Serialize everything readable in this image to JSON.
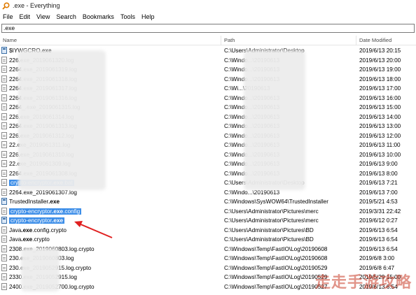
{
  "window": {
    "title": ".exe - Everything"
  },
  "menu": [
    "File",
    "Edit",
    "View",
    "Search",
    "Bookmarks",
    "Tools",
    "Help"
  ],
  "search": {
    "value": ".exe"
  },
  "columns": {
    "name": "Name",
    "path": "Path",
    "date": "Date Modified"
  },
  "rows": [
    {
      "pre": "$IYWGCRO",
      "bold": ".exe",
      "post": "",
      "icon": "exe",
      "path": "C:\\Users\\Administrator\\Desktop",
      "date": "2019/6/13 20:15",
      "selected": false
    },
    {
      "pre": "226",
      "bold": "",
      "post": ".exe_2019061320.log",
      "icon": "txt",
      "path": "C:\\Windo...\\20190613",
      "date": "2019/6/13 20:00",
      "selected": false
    },
    {
      "pre": "2264",
      "bold": "",
      "post": ".exe_2019061319.log",
      "icon": "txt",
      "path": "C:\\Windo...\\20190613",
      "date": "2019/6/13 19:00",
      "selected": false
    },
    {
      "pre": "2264",
      "bold": "",
      "post": ".exe_2019061318.log",
      "icon": "txt",
      "path": "C:\\Windo...\\20190613",
      "date": "2019/6/13 18:00",
      "selected": false
    },
    {
      "pre": "2264",
      "bold": "",
      "post": ".exe_2019061317.log",
      "icon": "txt",
      "path": "C:\\Wi...\\20190613",
      "date": "2019/6/13 17:00",
      "selected": false
    },
    {
      "pre": "2264",
      "bold": "",
      "post": ".exe_2019061316.log",
      "icon": "txt",
      "path": "C:\\Windo...\\20190613",
      "date": "2019/6/13 16:00",
      "selected": false
    },
    {
      "pre": "2264_",
      "bold": "",
      "post": ".exe_2019061315.log",
      "icon": "txt",
      "path": "C:\\Windo...\\20190613",
      "date": "2019/6/13 15:00",
      "selected": false
    },
    {
      "pre": "226",
      "bold": "",
      "post": ".exe_2019061314.log",
      "icon": "txt",
      "path": "C:\\Windo...\\20190613",
      "date": "2019/6/13 14:00",
      "selected": false
    },
    {
      "pre": "2264",
      "bold": "",
      "post": ".exe_2019061313.log",
      "icon": "txt",
      "path": "C:\\Windo...\\20190613",
      "date": "2019/6/13 13:00",
      "selected": false
    },
    {
      "pre": "226",
      "bold": "",
      "post": ".exe_2019061312.log",
      "icon": "txt",
      "path": "C:\\Windo...\\20190613",
      "date": "2019/6/13 12:00",
      "selected": false
    },
    {
      "pre": "22",
      "bold": "",
      "post": ".exe_2019061311.log",
      "icon": "txt",
      "path": "C:\\Windo...\\20190613",
      "date": "2019/6/13 11:00",
      "selected": false
    },
    {
      "pre": "226",
      "bold": "",
      "post": ".exe_2019061310.log",
      "icon": "txt",
      "path": "C:\\Windo...\\20190613",
      "date": "2019/6/13 10:00",
      "selected": false
    },
    {
      "pre": "22",
      "bold": "",
      "post": ".exe_2019061309.log",
      "icon": "txt",
      "path": "C:\\Windo...\\20190613",
      "date": "2019/6/13 9:00",
      "selected": false
    },
    {
      "pre": "2264",
      "bold": "",
      "post": ".exe_2019061308.log",
      "icon": "txt",
      "path": "C:\\Windo...\\20190613",
      "date": "2019/6/13 8:00",
      "selected": false
    },
    {
      "pre": "crypto-encryptor",
      "bold": ".exe",
      "post": ".bat",
      "icon": "txt",
      "path": "C:\\Users\\Administrator\\Desktop",
      "date": "2019/6/13 7:21",
      "selected": true
    },
    {
      "pre": "2264",
      "bold": "",
      "post": ".exe_2019061307.log",
      "icon": "txt",
      "path": "C:\\Windo...\\20190613",
      "date": "2019/6/13 7:00",
      "selected": false
    },
    {
      "pre": "TrustedInstaller",
      "bold": ".exe",
      "post": "",
      "icon": "exe",
      "path": "C:\\Windows\\SysWOW64\\TrustedInstaller",
      "date": "2019/5/21 4:53",
      "selected": false
    },
    {
      "pre": "crypto-encryptor",
      "bold": ".exe",
      "post": ".config",
      "icon": "txt",
      "path": "C:\\Users\\Administrator\\Pictures\\merc",
      "date": "2019/3/31 22:42",
      "selected": true
    },
    {
      "pre": "crypto-encryptor",
      "bold": ".exe",
      "post": "",
      "icon": "exe",
      "path": "C:\\Users\\Administrator\\Pictures\\merc",
      "date": "2019/6/12 0:27",
      "selected": true
    },
    {
      "pre": "Java",
      "bold": ".exe",
      "post": ".config.crypto",
      "icon": "txt",
      "path": "C:\\Users\\Administrator\\Pictures\\BD",
      "date": "2019/6/13 6:54",
      "selected": false
    },
    {
      "pre": "Java",
      "bold": ".exe",
      "post": ".crypto",
      "icon": "txt",
      "path": "C:\\Users\\Administrator\\Pictures\\BD",
      "date": "2019/6/13 6:54",
      "selected": false
    },
    {
      "pre": "2308",
      "bold": "",
      "post": ".exe_2019060803.log.crypto",
      "icon": "txt",
      "path": "C:\\Windows\\Temp\\FastIO\\Log\\20190608",
      "date": "2019/6/13 6:54",
      "selected": false
    },
    {
      "pre": "230",
      "bold": "",
      "post": ".exe_2019060803.log",
      "icon": "txt",
      "path": "C:\\Windows\\Temp\\FastIO\\Log\\20190608",
      "date": "2019/6/8 3:00",
      "selected": false
    },
    {
      "pre": "230",
      "bold": "",
      "post": ".exe_2019052915.log.crypto",
      "icon": "txt",
      "path": "C:\\Windows\\Temp\\FastIO\\Log\\20190529",
      "date": "2019/6/8 6:47",
      "selected": false
    },
    {
      "pre": "2330",
      "bold": "",
      "post": ".exe_2019052915.log",
      "icon": "txt",
      "path": "C:\\Windows\\Temp\\FastIO\\Log\\20190529",
      "date": "2019/5/29 15:00",
      "selected": false
    },
    {
      "pre": "2400",
      "bold": "",
      "post": ".exe_2019052700.log.crypto",
      "icon": "txt",
      "path": "C:\\Windows\\Temp\\FastIO\\Log\\20190527",
      "date": "2019/6/13 6:54",
      "selected": false
    }
  ],
  "watermark": "走走手游攻略"
}
